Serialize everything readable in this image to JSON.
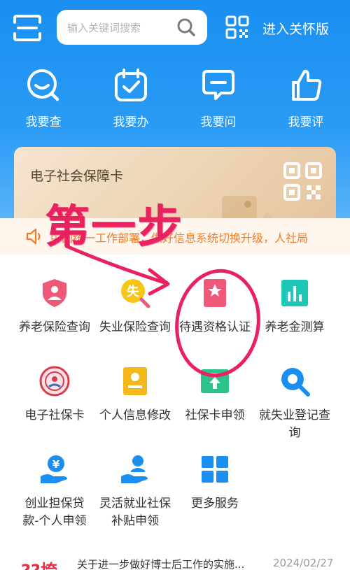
{
  "header": {
    "search_placeholder": "输入关键词搜索",
    "care_mode": "进入关怀版"
  },
  "quick_actions": [
    {
      "label": "我要查",
      "icon": "search-smile-icon"
    },
    {
      "label": "我要办",
      "icon": "calendar-check-icon"
    },
    {
      "label": "我要问",
      "icon": "chat-bubble-icon"
    },
    {
      "label": "我要评",
      "icon": "thumbs-up-icon"
    }
  ],
  "card": {
    "title": "电子社会保障卡"
  },
  "notice": {
    "text": "中国统一工作部署，做好信息系统切换升级，人社局"
  },
  "annotation": {
    "step_text": "第一步"
  },
  "services": [
    {
      "label": "养老保险查询",
      "icon": "shield-icon",
      "color": "#f0587a"
    },
    {
      "label": "失业保险查询",
      "icon": "unemployment-search-icon",
      "color": "#f5c518"
    },
    {
      "label": "待遇资格认证",
      "icon": "certificate-star-icon",
      "color": "#f0587a"
    },
    {
      "label": "养老金测算",
      "icon": "bar-chart-icon",
      "color": "#1fc7b6"
    },
    {
      "label": "电子社保卡",
      "icon": "social-security-seal-icon",
      "color": "#d93b4c"
    },
    {
      "label": "个人信息修改",
      "icon": "id-card-icon",
      "color": "#f5b81a"
    },
    {
      "label": "社保卡申领",
      "icon": "upload-card-icon",
      "color": "#2cc28a"
    },
    {
      "label": "就失业登记查询",
      "icon": "magnifier-icon",
      "color": "#1a8ff0"
    },
    {
      "label": "创业担保贷款-个人申领",
      "icon": "yuan-hand-icon",
      "color": "#1a8ff0"
    },
    {
      "label": "灵活就业社保补贴申领",
      "icon": "person-hand-icon",
      "color": "#1a8ff0"
    },
    {
      "label": "更多服务",
      "icon": "grid-icon",
      "color": "#1a8ff0"
    }
  ],
  "news": {
    "tag": "??垮",
    "title": "关于进一步做好博士后工作的实施...",
    "date": "2024/02/27"
  }
}
